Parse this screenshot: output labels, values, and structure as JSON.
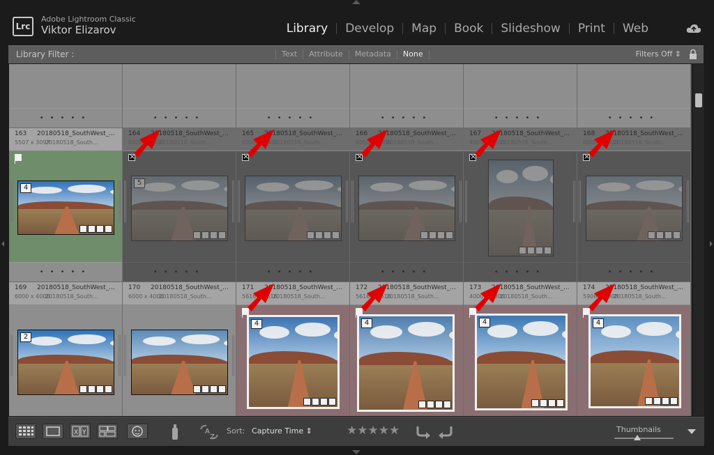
{
  "app": {
    "logo": "Lrc",
    "name": "Adobe Lightroom Classic",
    "user": "Viktor Elizarov"
  },
  "modules": [
    "Library",
    "Develop",
    "Map",
    "Book",
    "Slideshow",
    "Print",
    "Web"
  ],
  "active_module": "Library",
  "filter_bar": {
    "label": "Library Filter :",
    "tabs": [
      "Text",
      "Attribute",
      "Metadata",
      "None"
    ],
    "active_tab": "None",
    "filters_off": "Filters Off ⇕"
  },
  "grid": {
    "rows": [
      {
        "cells": [
          {
            "index": "",
            "file": "",
            "dims": "",
            "file2": "",
            "state": "normal"
          },
          {
            "index": "",
            "file": "",
            "dims": "",
            "file2": "",
            "state": "normal"
          },
          {
            "index": "",
            "file": "",
            "dims": "",
            "file2": "",
            "state": "normal"
          },
          {
            "index": "",
            "file": "",
            "dims": "",
            "file2": "",
            "state": "normal"
          },
          {
            "index": "",
            "file": "",
            "dims": "",
            "file2": "",
            "state": "normal"
          },
          {
            "index": "",
            "file": "",
            "dims": "",
            "file2": "",
            "state": "normal"
          }
        ]
      },
      {
        "cells": [
          {
            "index": "163",
            "file": "20180518_SouthWest_...",
            "dims": "5507 x 3097",
            "file2": "20180518_South...",
            "state": "picked",
            "stars": "4",
            "flag": "pick"
          },
          {
            "index": "164",
            "file": "20180518_SouthWest_...",
            "dims": "6000 x 4000",
            "file2": "20180518_South...",
            "state": "rejected",
            "stars": "5",
            "flag": "reject"
          },
          {
            "index": "165",
            "file": "20180518_SouthWest_...",
            "dims": "6000 x 4000",
            "file2": "20180518_South...",
            "state": "rejected",
            "stars": "",
            "flag": "reject"
          },
          {
            "index": "166",
            "file": "20180518_SouthWest_...",
            "dims": "6000 x 4000",
            "file2": "20180518_South...",
            "state": "rejected",
            "stars": "",
            "flag": "reject"
          },
          {
            "index": "167",
            "file": "20180518_SouthWest_...",
            "dims": "4000 x 6000",
            "file2": "20180518_South...",
            "state": "rejected",
            "stars": "",
            "flag": "reject"
          },
          {
            "index": "168",
            "file": "20180518_SouthWest_...",
            "dims": "6000 x 4000",
            "file2": "20180518_South...",
            "state": "rejected",
            "stars": "",
            "flag": "reject"
          }
        ]
      },
      {
        "cells": [
          {
            "index": "169",
            "file": "20180518_SouthWest_...",
            "dims": "6000 x 4000",
            "file2": "20180518_South...",
            "state": "normal",
            "stars": "2",
            "flag": ""
          },
          {
            "index": "170",
            "file": "20180518_SouthWest_...",
            "dims": "6000 x 4000",
            "file2": "20180518_South...",
            "state": "normal",
            "stars": "",
            "flag": ""
          },
          {
            "index": "171",
            "file": "20180518_SouthWest_...",
            "dims": "5616 x 5616",
            "file2": "20180518_South...",
            "state": "selected",
            "stars": "4",
            "flag": "pick"
          },
          {
            "index": "172",
            "file": "20180518_SouthWest_...",
            "dims": "5616 x 5616",
            "file2": "20180518_South...",
            "state": "selected",
            "stars": "4",
            "flag": "pick"
          },
          {
            "index": "173",
            "file": "20180518_SouthWest_...",
            "dims": "4000 x 6000",
            "file2": "20180518_South...",
            "state": "selected",
            "stars": "4",
            "flag": "pick"
          },
          {
            "index": "174",
            "file": "20180518_SouthWest_...",
            "dims": "5908 x 5908",
            "file2": "20180518_South...",
            "state": "selected",
            "stars": "4",
            "flag": "pick"
          }
        ]
      }
    ]
  },
  "toolbar": {
    "sort_label": "Sort:",
    "sort_value": "Capture Time ⇕",
    "rating_stars": "★★★★★",
    "thumbnails_label": "Thumbnails",
    "view_buttons": [
      "grid-view",
      "loupe-view",
      "compare-view",
      "survey-view",
      "people-view"
    ]
  },
  "colors": {
    "pick_cell": "#6f8c6b",
    "selected_cell": "#8b6e71",
    "arrow": "#e00000"
  }
}
